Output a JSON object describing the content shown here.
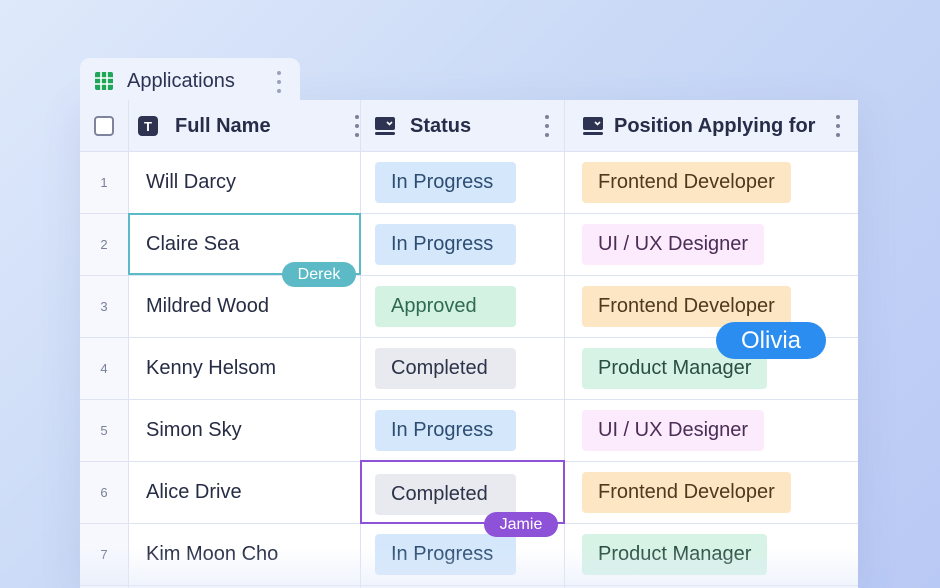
{
  "tab": {
    "label": "Applications",
    "icon": "spreadsheet-grid-icon"
  },
  "columns": {
    "full_name": {
      "label": "Full Name",
      "icon": "text-field-icon",
      "icon_glyph": "T"
    },
    "status": {
      "label": "Status",
      "icon": "dropdown-field-icon"
    },
    "position": {
      "label": "Position Applying for",
      "icon": "dropdown-field-icon"
    }
  },
  "rows": [
    {
      "num": "1",
      "name": "Will Darcy",
      "status": "In Progress",
      "position": "Frontend Developer"
    },
    {
      "num": "2",
      "name": "Claire Sea",
      "status": "In Progress",
      "position": "UI / UX Designer"
    },
    {
      "num": "3",
      "name": "Mildred Wood",
      "status": "Approved",
      "position": "Frontend Developer"
    },
    {
      "num": "4",
      "name": "Kenny Helsom",
      "status": "Completed",
      "position": "Product Manager"
    },
    {
      "num": "5",
      "name": "Simon Sky",
      "status": "In Progress",
      "position": "UI / UX Designer"
    },
    {
      "num": "6",
      "name": "Alice Drive",
      "status": "Completed",
      "position": "Frontend Developer"
    },
    {
      "num": "7",
      "name": "Kim Moon Cho",
      "status": "In Progress",
      "position": "Product Manager"
    }
  ],
  "collaborators": {
    "derek": {
      "name": "Derek",
      "color": "#5bbac6"
    },
    "jamie": {
      "name": "Jamie",
      "color": "#8e52d8"
    },
    "olivia": {
      "name": "Olivia",
      "color": "#2b8df0"
    }
  },
  "colors": {
    "in_progress": "#d5e8fb",
    "approved": "#d3f2e2",
    "completed": "#e8eaf0",
    "frontend": "#fde6c3",
    "uiux": "#fcebfc",
    "product_manager": "#d7f3e6"
  }
}
